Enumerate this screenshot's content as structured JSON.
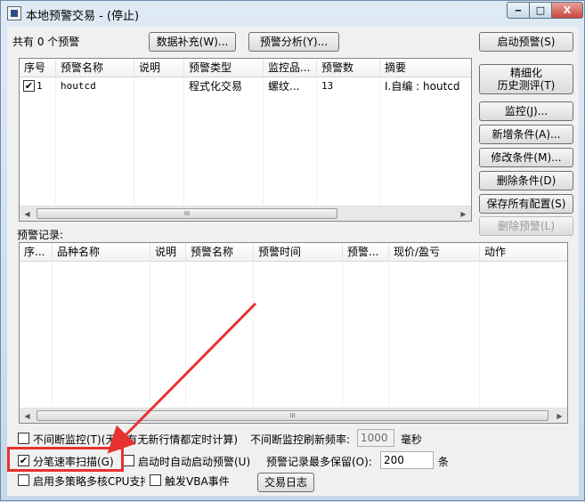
{
  "window": {
    "title": "本地预警交易 - (停止)",
    "min_label": "‒",
    "max_label": "□",
    "close_label": "X"
  },
  "top": {
    "count_text": "共有 0 个预警"
  },
  "buttons": {
    "data_supplement": "数据补充(W)...",
    "alert_analysis": "预警分析(Y)...",
    "start_alert": "启动预警(S)",
    "refine_line1": "精细化",
    "refine_line2": "历史测评(T)",
    "monitor": "监控(J)...",
    "add_condition": "新增条件(A)...",
    "modify_condition": "修改条件(M)...",
    "delete_condition": "删除条件(D)",
    "save_all": "保存所有配置(S)",
    "delete_alert": "删除预警(L)",
    "trade_log": "交易日志"
  },
  "alert_table": {
    "columns": [
      "序号",
      "预警名称",
      "说明",
      "预警类型",
      "监控品...",
      "预警数",
      "摘要"
    ],
    "rows": [
      {
        "checked": true,
        "index": "1",
        "name": "houtcd",
        "desc": "",
        "type": "程式化交易",
        "product": "螺纹...",
        "count": "13",
        "summary": "I.自编 : houtcd"
      }
    ],
    "scroll_glyph": "III"
  },
  "records": {
    "label": "预警记录:",
    "columns": [
      "序...",
      "品种名称",
      "说明",
      "预警名称",
      "预警时间",
      "预警...",
      "现价/盈亏",
      "动作"
    ],
    "scroll_glyph": "III"
  },
  "options": {
    "continuous_monitor": {
      "checked": false,
      "label": "不间断监控(T)(无论有无新行情都定时计算)"
    },
    "refresh_label": "不间断监控刷新频率:",
    "refresh_value": "1000",
    "refresh_unit": "毫秒",
    "tick_scan": {
      "checked": true,
      "label": "分笔速率扫描(G)"
    },
    "auto_start": {
      "checked": false,
      "label": "启动时自动启动预警(U)"
    },
    "max_records_label": "预警记录最多保留(O):",
    "max_records_value": "200",
    "max_records_unit": "条",
    "multi_cpu": {
      "checked": false,
      "label": "启用多策略多核CPU支持"
    },
    "vba_event": {
      "checked": false,
      "label": "触发VBA事件"
    }
  },
  "annotation_color": "#e8322e"
}
